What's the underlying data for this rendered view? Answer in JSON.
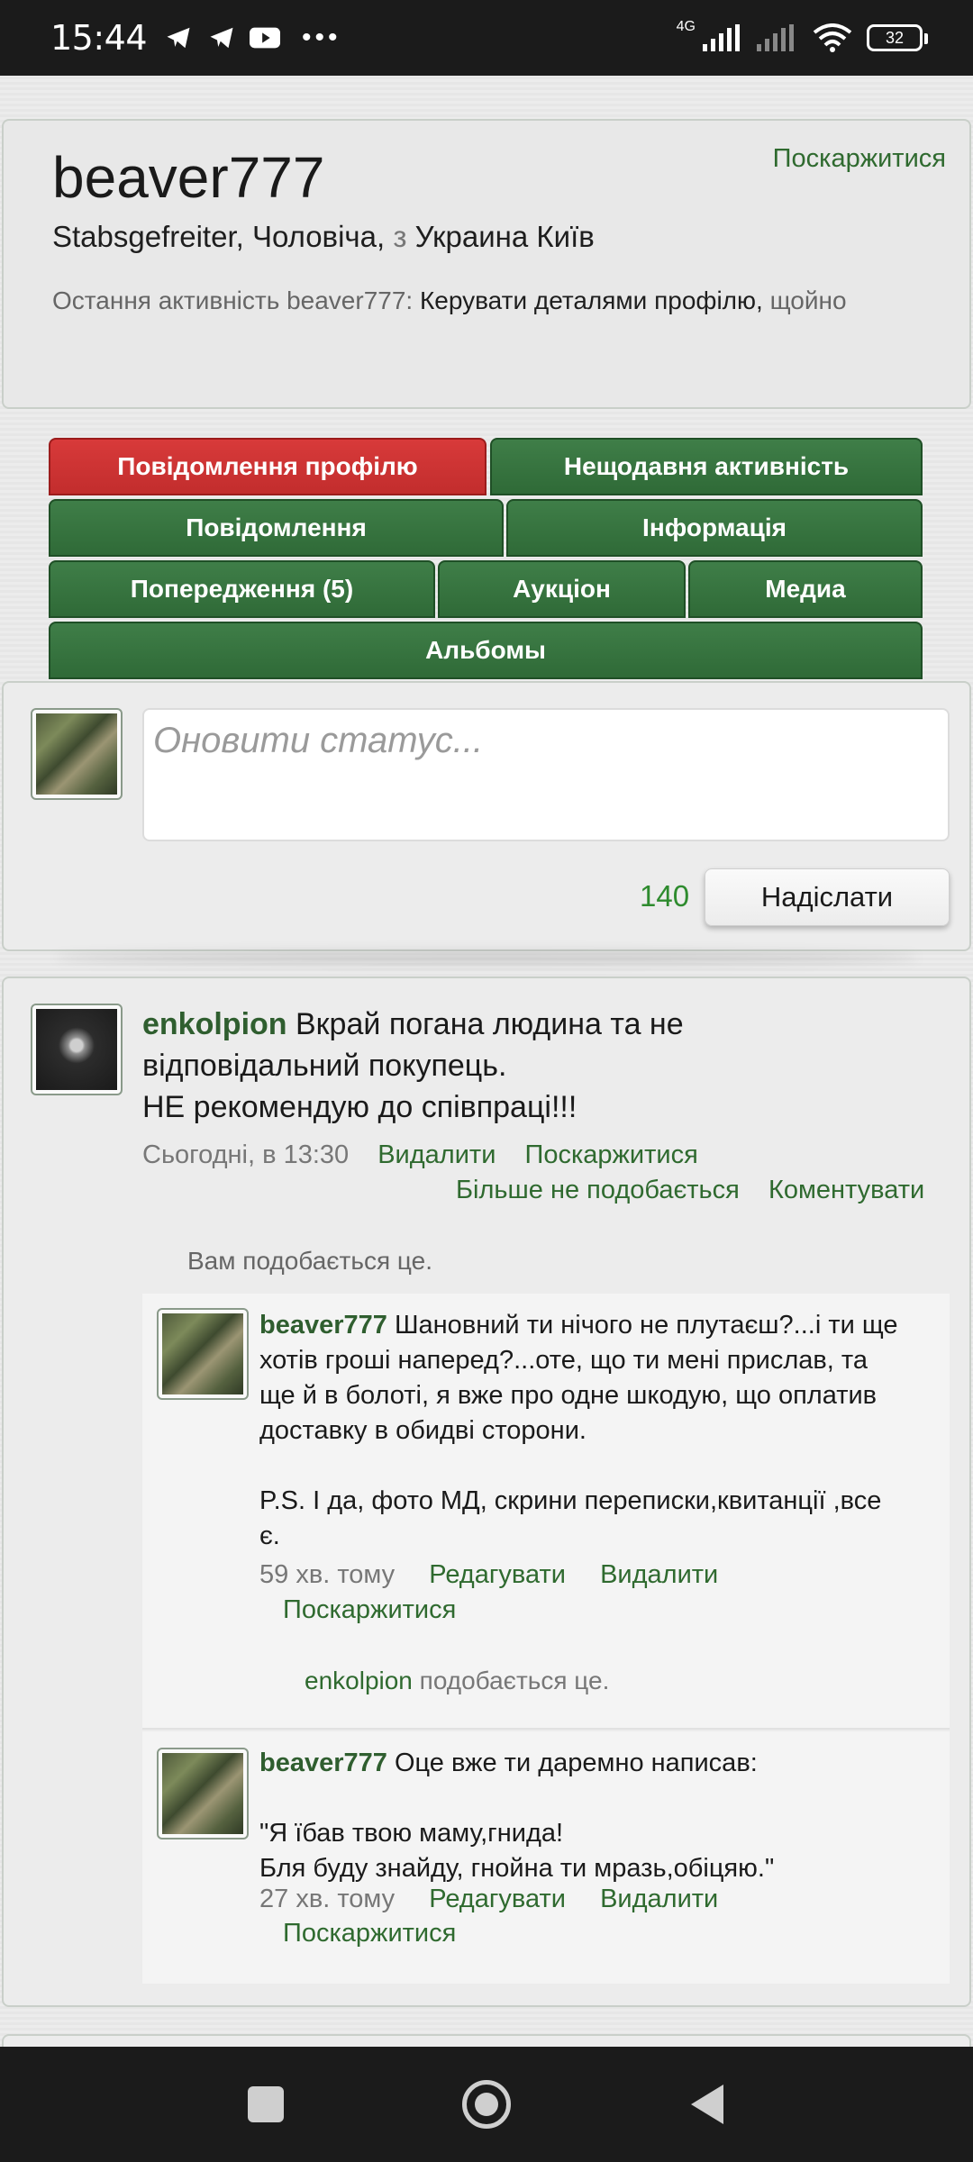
{
  "status_bar": {
    "time": "15:44",
    "network": "4G",
    "battery": "32"
  },
  "profile": {
    "username": "beaver777",
    "report_label": "Поскаржитися",
    "subtitle_rank": "Stabsgefreiter, Чоловіча, ",
    "subtitle_from": "з",
    "subtitle_location": " Украина Київ",
    "last_activity_prefix": "Остання активність beaver777: ",
    "last_activity_action": "Керувати деталями профілю,",
    "last_activity_time": " щойно"
  },
  "tabs": [
    {
      "label": "Повідомлення профілю",
      "active": true
    },
    {
      "label": "Нещодавня активність"
    },
    {
      "label": "Повідомлення"
    },
    {
      "label": "Інформація"
    },
    {
      "label": "Попередження (5)"
    },
    {
      "label": "Аукціон"
    },
    {
      "label": "Медиа"
    },
    {
      "label": "Альбомы"
    }
  ],
  "status_update": {
    "placeholder": "Оновити статус...",
    "counter": "140",
    "submit_label": "Надіслати"
  },
  "post": {
    "author": "enkolpion",
    "text_line1": " Вкрай погана людина та не",
    "text_line2": "відповідальний покупець.",
    "text_line3": "НЕ рекомендую до співпраці!!!",
    "time": "Сьогодні, в 13:30",
    "delete_label": "Видалити",
    "report_label": "Поскаржитися",
    "unlike_label": "Більше не подобається",
    "comment_label": "Коментувати",
    "likes_text": "Вам подобається це."
  },
  "comments": [
    {
      "author": "beaver777",
      "text_lines": [
        " Шановний ти нічого не плутаєш?...і ти ще",
        "хотів гроші наперед?...оте, що ти мені прислав, та",
        "ще й в болоті, я вже про одне шкодую, що оплатив",
        "доставку в обидві сторони.",
        "",
        "P.S. І да, фото МД, скрини переписки,квитанції ,все",
        "є."
      ],
      "time": "59 хв. тому",
      "edit_label": "Редагувати",
      "delete_label": "Видалити",
      "report_label": "Поскаржитися",
      "liker": "enkolpion",
      "likes_suffix": " подобається це."
    },
    {
      "author": "beaver777",
      "text_lines": [
        " Оце вже ти даремно написав:",
        "",
        "\"Я їбав твою маму,гнида!",
        "Бля буду знайду, гнойна ти мразь,обіцяю.\""
      ],
      "time": "27 хв. тому",
      "edit_label": "Редагувати",
      "delete_label": "Видалити",
      "report_label": "Поскаржитися"
    }
  ],
  "colors": {
    "tab_green": "#2f6a37",
    "tab_active_red": "#c22d2d",
    "link_green": "#2f6a2f",
    "counter_green": "#2e8b2e"
  }
}
